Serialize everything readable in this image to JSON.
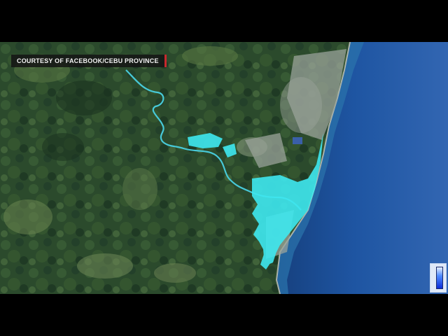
{
  "overlay": {
    "credit_text": "COURTESY OF FACEBOOK/CEBU PROVINCE"
  },
  "colors": {
    "land_dark": "#1f3a22",
    "land_mid": "#2f5230",
    "land_light": "#4a6b3c",
    "sea_near": "#1b4f9a",
    "sea_far": "#2a5fae",
    "flood": "#3ee8f0",
    "river": "#47c9d8",
    "credit_accent": "#c8282d"
  },
  "legend": {
    "icon": "flood-depth-colorbar-icon"
  }
}
